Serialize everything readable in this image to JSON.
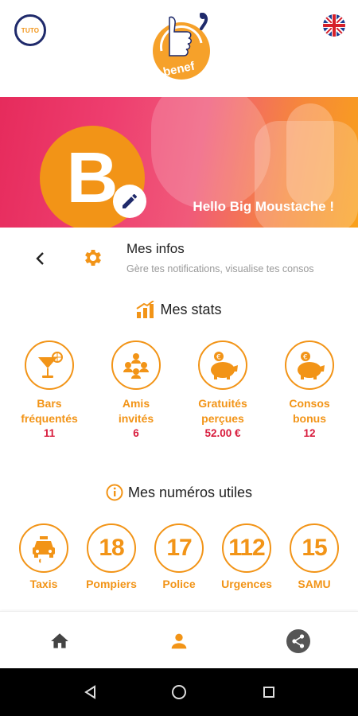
{
  "header": {
    "tuto_label": "TUTO",
    "logo_text": "benef",
    "language_icon": "uk-flag-icon"
  },
  "banner": {
    "avatar_letter": "B",
    "greeting": "Hello Big Moustache !"
  },
  "infos": {
    "title": "Mes infos",
    "subtitle": "Gère tes notifications, visualise tes consos"
  },
  "stats": {
    "title": "Mes stats",
    "items": [
      {
        "icon": "cocktail-icon",
        "label_line1": "Bars",
        "label_line2": "fréquentés",
        "value": "11"
      },
      {
        "icon": "friends-icon",
        "label_line1": "Amis",
        "label_line2": "invités",
        "value": "6"
      },
      {
        "icon": "piggy-bank-icon",
        "label_line1": "Gratuités",
        "label_line2": "perçues",
        "value": "52.00 €"
      },
      {
        "icon": "piggy-bank-icon",
        "label_line1": "Consos",
        "label_line2": "bonus",
        "value": "12"
      }
    ]
  },
  "numbers": {
    "title": "Mes numéros utiles",
    "items": [
      {
        "label": "Taxis",
        "number": ""
      },
      {
        "label": "Pompiers",
        "number": "18"
      },
      {
        "label": "Police",
        "number": "17"
      },
      {
        "label": "Urgences",
        "number": "112"
      },
      {
        "label": "SAMU",
        "number": "15"
      }
    ]
  },
  "colors": {
    "accent": "#f29417",
    "value_red": "#d81b3c",
    "navy": "#1f2a6b"
  }
}
